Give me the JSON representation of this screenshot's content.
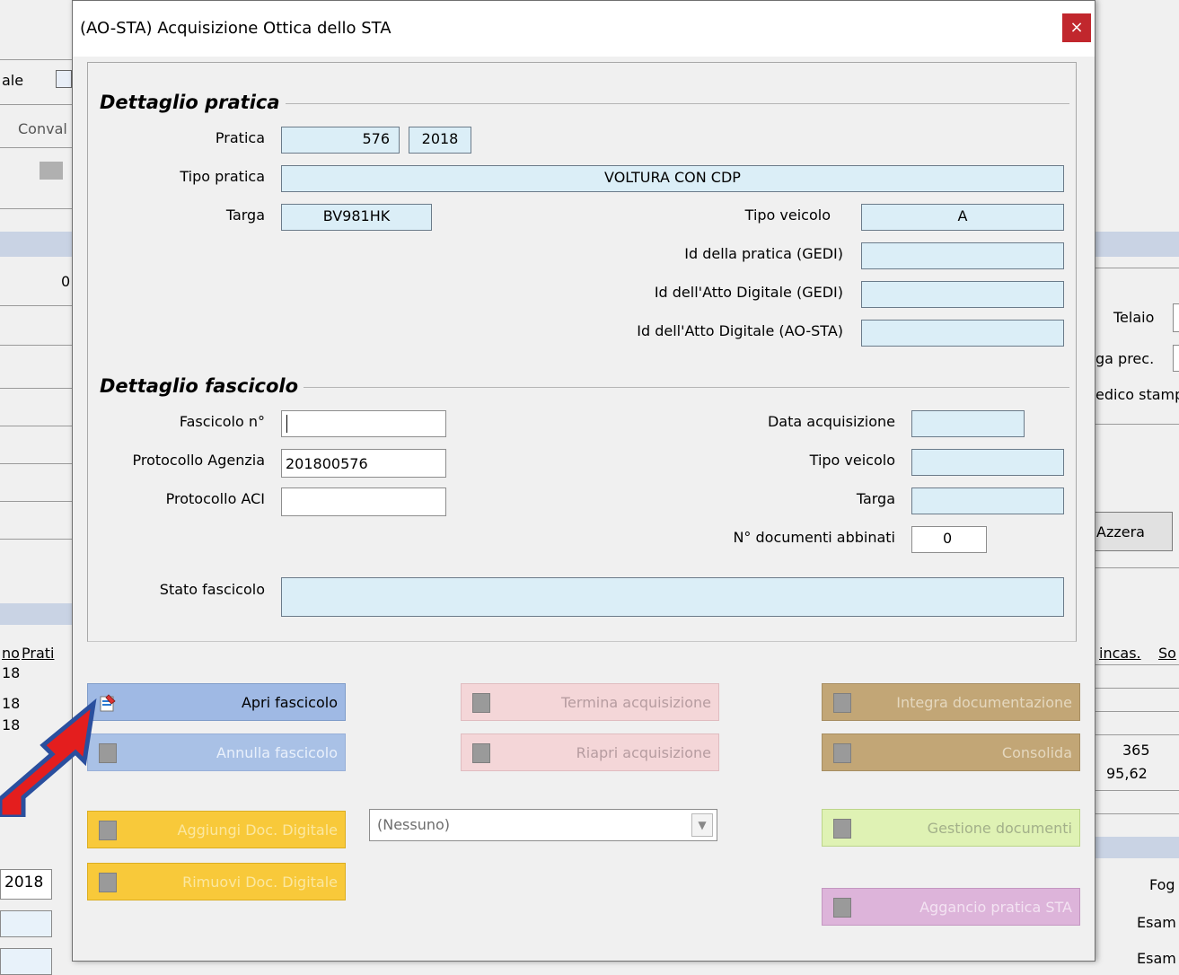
{
  "background_app": {
    "toolbar_text_1": "ale",
    "toolbar_text_2": "Conval",
    "field_zero": "0",
    "right_labels": {
      "telaio": "Telaio",
      "targa_prec": "ga prec.",
      "medico": "edico stamp"
    },
    "azzera_button": "Azzera",
    "table_headers": {
      "h1": "no",
      "h2": "Prati",
      "h3": "incas.",
      "h4": "So"
    },
    "left_col_values": [
      "18",
      "18",
      "18",
      "18"
    ],
    "right_values": [
      "365",
      "95,62"
    ],
    "year_field": "2018",
    "bottom_right_labels": [
      "Fog",
      "Esam",
      "Esam"
    ]
  },
  "dialog": {
    "title": "(AO-STA) Acquisizione Ottica dello STA",
    "close_label": "×",
    "dettaglio_pratica": {
      "heading": "Dettaglio pratica",
      "pratica_label": "Pratica",
      "pratica_number": "576",
      "pratica_year": "2018",
      "tipo_pratica_label": "Tipo pratica",
      "tipo_pratica_value": "VOLTURA CON CDP",
      "targa_label": "Targa",
      "targa_value": "BV981HK",
      "tipo_veicolo_label": "Tipo veicolo",
      "tipo_veicolo_value": "A",
      "id_pratica_gedi_label": "Id della pratica (GEDI)",
      "id_pratica_gedi_value": "",
      "id_atto_gedi_label": "Id dell'Atto Digitale (GEDI)",
      "id_atto_gedi_value": "",
      "id_atto_aosta_label": "Id dell'Atto Digitale (AO-STA)",
      "id_atto_aosta_value": ""
    },
    "dettaglio_fascicolo": {
      "heading": "Dettaglio fascicolo",
      "fascicolo_label": "Fascicolo n°",
      "fascicolo_value": "",
      "protocollo_agenzia_label": "Protocollo Agenzia",
      "protocollo_agenzia_value": "201800576",
      "protocollo_aci_label": "Protocollo ACI",
      "protocollo_aci_value": "",
      "data_acquisizione_label": "Data acquisizione",
      "data_acquisizione_value": "",
      "tipo_veicolo_label": "Tipo veicolo",
      "tipo_veicolo_value": "",
      "targa_label": "Targa",
      "targa_value": "",
      "n_documenti_label": "N° documenti abbinati",
      "n_documenti_value": "0",
      "stato_label": "Stato fascicolo",
      "stato_value": ""
    },
    "buttons": {
      "apri_fascicolo": "Apri fascicolo",
      "annulla_fascicolo": "Annulla fascicolo",
      "termina_acquisizione": "Termina acquisizione",
      "riapri_acquisizione": "Riapri acquisizione",
      "integra_documentazione": "Integra documentazione",
      "consolida": "Consolida",
      "aggiungi_doc_digitale": "Aggiungi Doc. Digitale",
      "rimuovi_doc_digitale": "Rimuovi Doc. Digitale",
      "gestione_documenti": "Gestione documenti",
      "aggancio_pratica_sta": "Aggancio pratica STA"
    },
    "document_type_select": {
      "selected": "(Nessuno)"
    }
  },
  "annotation": {
    "arrow_color": "#e41e1e",
    "arrow_outline": "#2a4f9e",
    "target": "apri-fascicolo-button"
  }
}
